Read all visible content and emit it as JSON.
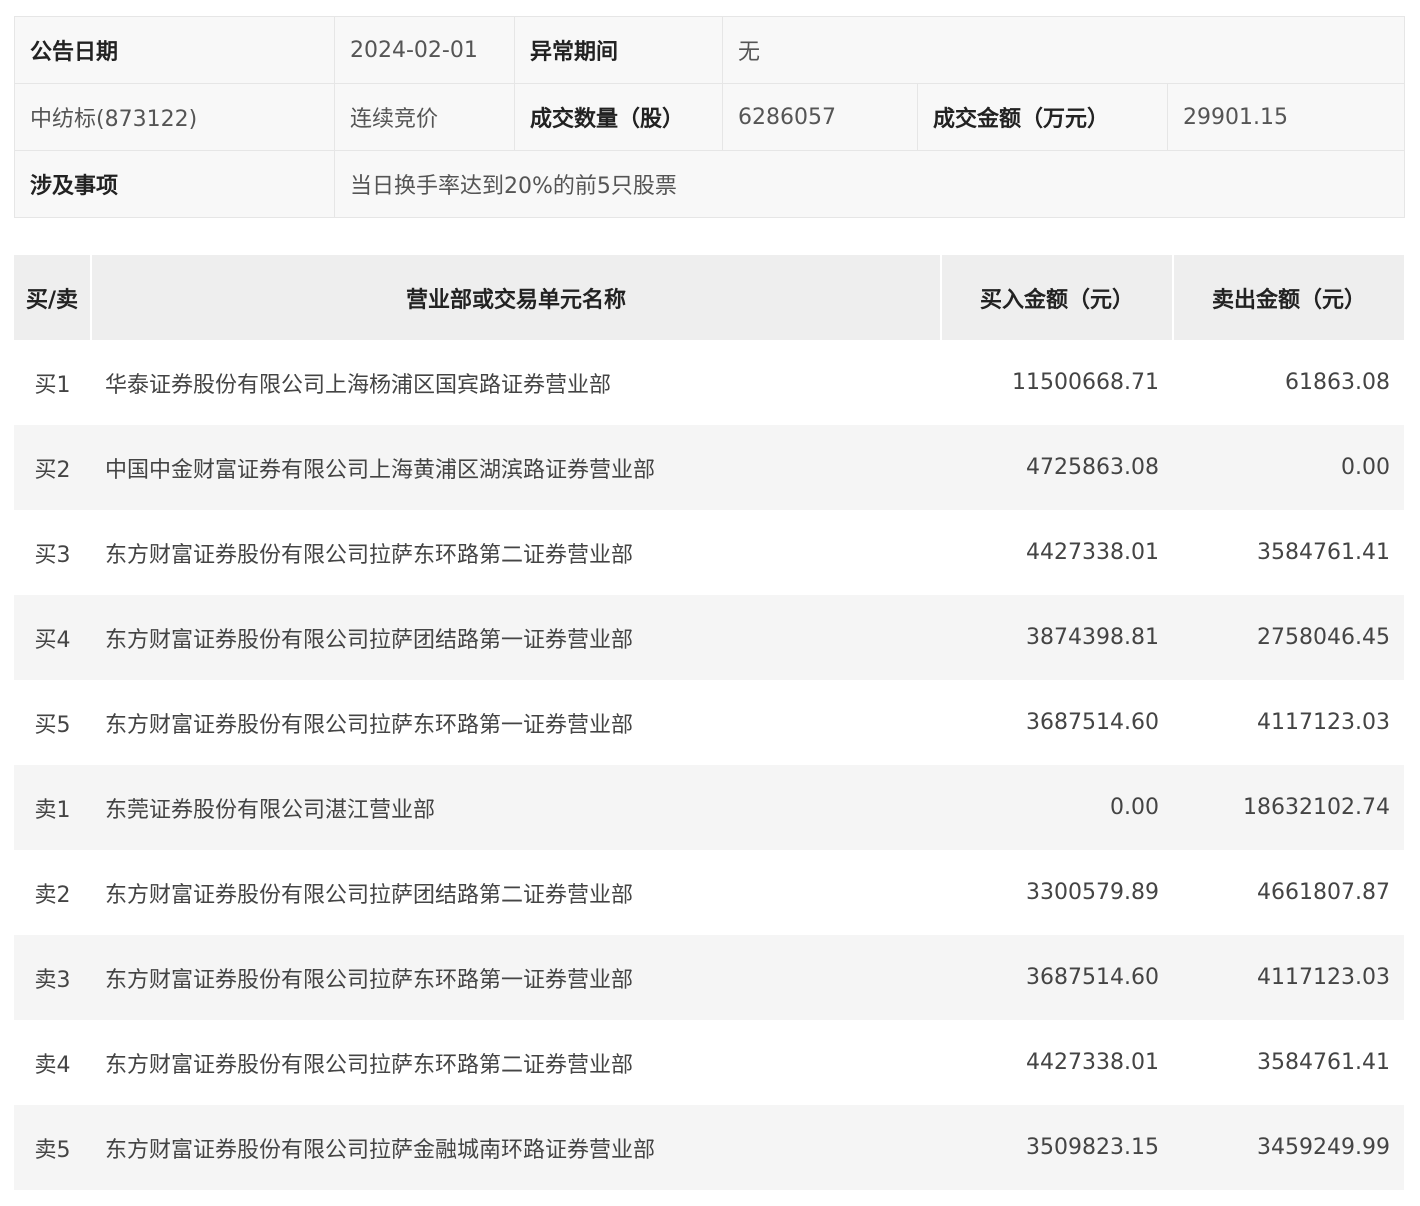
{
  "info": {
    "date_label": "公告日期",
    "date_value": "2024-02-01",
    "period_label": "异常期间",
    "period_value": "无",
    "stock_name": "中纺标(873122)",
    "trade_method": "连续竞价",
    "volume_label": "成交数量（股）",
    "volume_value": "6286057",
    "amount_label": "成交金额（万元）",
    "amount_value": "29901.15",
    "matter_label": "涉及事项",
    "matter_value": "当日换手率达到20%的前5只股票"
  },
  "table": {
    "headers": [
      "买/卖",
      "营业部或交易单元名称",
      "买入金额（元）",
      "卖出金额（元）"
    ],
    "rows": [
      {
        "side": "买1",
        "name": "华泰证券股份有限公司上海杨浦区国宾路证券营业部",
        "buy": "11500668.71",
        "sell": "61863.08"
      },
      {
        "side": "买2",
        "name": "中国中金财富证券有限公司上海黄浦区湖滨路证券营业部",
        "buy": "4725863.08",
        "sell": "0.00"
      },
      {
        "side": "买3",
        "name": "东方财富证券股份有限公司拉萨东环路第二证券营业部",
        "buy": "4427338.01",
        "sell": "3584761.41"
      },
      {
        "side": "买4",
        "name": "东方财富证券股份有限公司拉萨团结路第一证券营业部",
        "buy": "3874398.81",
        "sell": "2758046.45"
      },
      {
        "side": "买5",
        "name": "东方财富证券股份有限公司拉萨东环路第一证券营业部",
        "buy": "3687514.60",
        "sell": "4117123.03"
      },
      {
        "side": "卖1",
        "name": "东莞证券股份有限公司湛江营业部",
        "buy": "0.00",
        "sell": "18632102.74"
      },
      {
        "side": "卖2",
        "name": "东方财富证券股份有限公司拉萨团结路第二证券营业部",
        "buy": "3300579.89",
        "sell": "4661807.87"
      },
      {
        "side": "卖3",
        "name": "东方财富证券股份有限公司拉萨东环路第一证券营业部",
        "buy": "3687514.60",
        "sell": "4117123.03"
      },
      {
        "side": "卖4",
        "name": "东方财富证券股份有限公司拉萨东环路第二证券营业部",
        "buy": "4427338.01",
        "sell": "3584761.41"
      },
      {
        "side": "卖5",
        "name": "东方财富证券股份有限公司拉萨金融城南环路证券营业部",
        "buy": "3509823.15",
        "sell": "3459249.99"
      }
    ]
  }
}
